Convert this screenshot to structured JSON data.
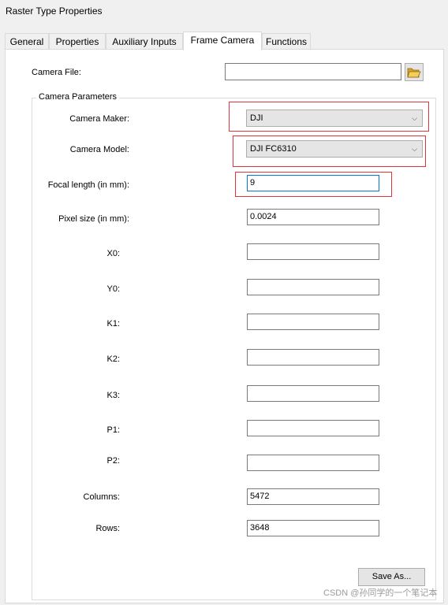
{
  "window": {
    "title": "Raster Type Properties"
  },
  "tabs": [
    {
      "label": "General"
    },
    {
      "label": "Properties"
    },
    {
      "label": "Auxiliary Inputs"
    },
    {
      "label": "Frame Camera"
    },
    {
      "label": "Functions"
    }
  ],
  "active_tab": "Frame Camera",
  "camera_file": {
    "label": "Camera File:",
    "value": ""
  },
  "group": {
    "title": "Camera Parameters"
  },
  "camera_maker": {
    "label": "Camera Maker:",
    "value": "DJI"
  },
  "camera_model": {
    "label": "Camera Model:",
    "value": "DJI FC6310"
  },
  "focal_length": {
    "label": "Focal length (in mm):",
    "value": "9"
  },
  "pixel_size": {
    "label": "Pixel size (in mm):",
    "value": "0.0024"
  },
  "x0": {
    "label": "X0:",
    "value": ""
  },
  "y0": {
    "label": "Y0:",
    "value": ""
  },
  "k1": {
    "label": "K1:",
    "value": ""
  },
  "k2": {
    "label": "K2:",
    "value": ""
  },
  "k3": {
    "label": "K3:",
    "value": ""
  },
  "p1": {
    "label": "P1:",
    "value": ""
  },
  "p2": {
    "label": "P2:",
    "value": ""
  },
  "columns": {
    "label": "Columns:",
    "value": "5472"
  },
  "rows": {
    "label": "Rows:",
    "value": "3648"
  },
  "save_as_label": "Save As...",
  "watermark": "CSDN @孙同学的一个笔记本",
  "colors": {
    "highlight": "#e0353a",
    "focus_border": "#0078d7",
    "folder": "#e8b536"
  },
  "icons": {
    "browse": "folder-open-icon",
    "dropdown": "chevron-down-icon"
  }
}
